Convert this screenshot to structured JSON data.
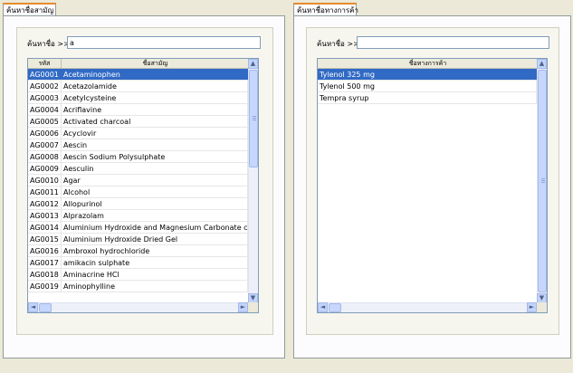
{
  "generic_panel": {
    "tab_label": "ค้นหาชื่อสามัญ",
    "search_label": "ค้นหาชื่อ >>",
    "search_value": "a",
    "columns": [
      "รหัส",
      "ชื่อสามัญ"
    ],
    "rows": [
      {
        "code": "AG0001",
        "name": "Acetaminophen"
      },
      {
        "code": "AG0002",
        "name": "Acetazolamide"
      },
      {
        "code": "AG0003",
        "name": "Acetylcysteine"
      },
      {
        "code": "AG0004",
        "name": "Acriflavine"
      },
      {
        "code": "AG0005",
        "name": "Activated charcoal"
      },
      {
        "code": "AG0006",
        "name": "Acyclovir"
      },
      {
        "code": "AG0007",
        "name": "Aescin"
      },
      {
        "code": "AG0008",
        "name": "Aescin Sodium Polysulphate"
      },
      {
        "code": "AG0009",
        "name": "Aesculin"
      },
      {
        "code": "AG0010",
        "name": "Agar"
      },
      {
        "code": "AG0011",
        "name": "Alcohol"
      },
      {
        "code": "AG0012",
        "name": "Allopurinol"
      },
      {
        "code": "AG0013",
        "name": "Alprazolam"
      },
      {
        "code": "AG0014",
        "name": "Aluminium Hydroxide and Magnesium Carbonate co-pre"
      },
      {
        "code": "AG0015",
        "name": "Aluminium Hydroxide Dried Gel"
      },
      {
        "code": "AG0016",
        "name": "Ambroxol hydrochloride"
      },
      {
        "code": "AG0017",
        "name": "amikacin sulphate"
      },
      {
        "code": "AG0018",
        "name": "Aminacrine HCl"
      },
      {
        "code": "AG0019",
        "name": "Aminophylline"
      }
    ]
  },
  "trade_panel": {
    "tab_label": "ค้นหาชื่อทางการค้า",
    "search_label": "ค้นหาชื่อ >>",
    "search_value": "",
    "columns": [
      "ชื่อทางการค้า"
    ],
    "rows": [
      {
        "name": "Tylenol 325 mg"
      },
      {
        "name": "Tylenol 500 mg"
      },
      {
        "name": "Tempra syrup"
      }
    ]
  },
  "colors": {
    "selection": "#316ac5",
    "tab_accent": "#e68b2c",
    "scrollbar": "#c1d3fb"
  }
}
